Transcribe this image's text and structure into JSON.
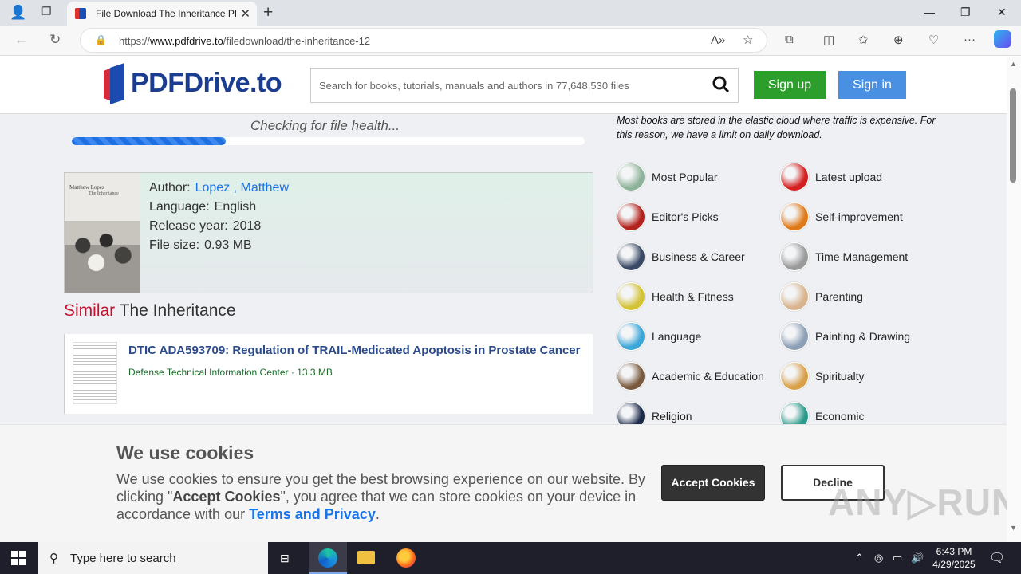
{
  "browser": {
    "tab_title": "File Download The Inheritance PDF",
    "url_prefix": "https://",
    "url_domain": "www.pdfdrive.to",
    "url_path": "/filedownload/the-inheritance-12"
  },
  "header": {
    "logo": "PDFDrive.to",
    "search_placeholder": "Search for books, tutorials, manuals and authors in 77,648,530 files",
    "signup": "Sign up",
    "signin": "Sign in"
  },
  "download": {
    "status": "Checking for file health...",
    "progress": 0.3
  },
  "book": {
    "cover_author": "Matthew Lopez",
    "cover_title": "The Inheritance",
    "author_label": "Author:",
    "author_last": "Lopez",
    "author_first": ", Matthew",
    "language_label": "Language:",
    "language": "English",
    "year_label": "Release year:",
    "year": "2018",
    "size_label": "File size:",
    "size": "0.93 MB"
  },
  "similar": {
    "prefix": "Similar",
    "title": "The Inheritance",
    "items": [
      {
        "title": "DTIC ADA593709: Regulation of TRAIL-Medicated Apoptosis in Prostate Cancer",
        "source": "Defense Technical Information Center · 13.3 MB"
      }
    ]
  },
  "sidebar": {
    "note": "Most books are stored in the elastic cloud where traffic is expensive. For this reason, we have a limit on daily download.",
    "categories": [
      {
        "label": "Most Popular",
        "color": "#8fb39a"
      },
      {
        "label": "Latest upload",
        "color": "#d42020"
      },
      {
        "label": "Editor's Picks",
        "color": "#b3221c"
      },
      {
        "label": "Self-improvement",
        "color": "#e07a18"
      },
      {
        "label": "Business & Career",
        "color": "#3a4a66"
      },
      {
        "label": "Time Management",
        "color": "#9a9a9a"
      },
      {
        "label": "Health & Fitness",
        "color": "#d4c235"
      },
      {
        "label": "Parenting",
        "color": "#d8b48e"
      },
      {
        "label": "Language",
        "color": "#3aa6d8"
      },
      {
        "label": "Painting & Drawing",
        "color": "#8c9fb5"
      },
      {
        "label": "Academic & Education",
        "color": "#7a5a3e"
      },
      {
        "label": "Spiritualty",
        "color": "#d9a04a"
      },
      {
        "label": "Religion",
        "color": "#1c2a4a"
      },
      {
        "label": "Economic",
        "color": "#2a9a8a"
      }
    ]
  },
  "cookie": {
    "heading": "We use cookies",
    "text_1": "We use cookies to ensure you get the best browsing experience on our website. By clicking \"",
    "text_bold": "Accept Cookies",
    "text_2": "\", you agree that we can store cookies on your device in accordance with our ",
    "link": "Terms and Privacy",
    "text_3": ".",
    "accept": "Accept Cookies",
    "decline": "Decline",
    "watermark": "ANY▷RUN"
  },
  "taskbar": {
    "search_placeholder": "Type here to search",
    "time": "6:43 PM",
    "date": "4/29/2025"
  }
}
